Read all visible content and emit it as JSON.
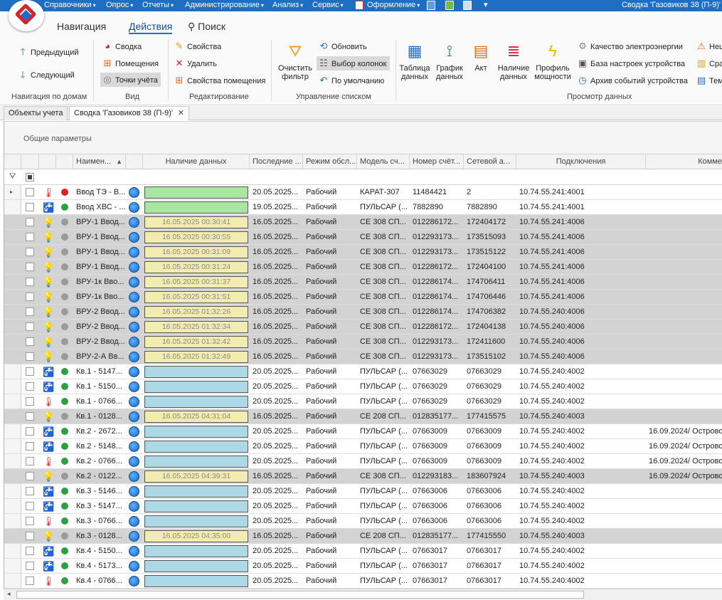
{
  "menu": [
    {
      "label": "Справочники"
    },
    {
      "label": "Опрос"
    },
    {
      "label": "Отчеты"
    },
    {
      "label": "Администрирование"
    },
    {
      "label": "Анализ"
    },
    {
      "label": "Сервис"
    },
    {
      "label": "Оформление"
    }
  ],
  "window_title": "Сводка 'Газовиков 38 (П-9)'",
  "ribbon_tabs": [
    {
      "label": "Навигация"
    },
    {
      "label": "Действия"
    },
    {
      "label": "Поиск"
    }
  ],
  "nav_group": {
    "prev": "Предыдущий",
    "next": "Следующий",
    "label": "Навигация по домам"
  },
  "view_group": {
    "summary": "Сводка",
    "rooms": "Помещения",
    "points": "Точки учёта",
    "label": "Вид"
  },
  "edit_group": {
    "props": "Свойства",
    "delete": "Удалить",
    "room_props": "Свойства помещения",
    "label": "Редактирование"
  },
  "list_group": {
    "clear_filter_1": "Очистить",
    "clear_filter_2": "фильтр",
    "refresh": "Обновить",
    "columns": "Выбор колонок",
    "default": "По умолчанию",
    "label": "Управление списком"
  },
  "view_data_group": {
    "table_1": "Таблица",
    "table_2": "данных",
    "graph_1": "График",
    "graph_2": "данных",
    "act": "Акт",
    "avail_1": "Наличие",
    "avail_2": "данных",
    "profile_1": "Профиль",
    "profile_2": "мощности",
    "quality": "Качество электроэнергии",
    "settings_db": "База настроек устройства",
    "events": "Архив событий устройства",
    "extra1": "Неш",
    "extra2": "Сра",
    "extra3": "Тем",
    "label": "Просмотр данных"
  },
  "doc_tabs": [
    {
      "label": "Объекты учета"
    },
    {
      "label": "Сводка 'Газовиков 38 (П-9)'"
    }
  ],
  "group_panel": "Общие параметры",
  "columns": {
    "name": "Наимен...",
    "avail": "Наличие данных",
    "last": "Последние ...",
    "mode": "Режим обсл...",
    "model": "Модель сч...",
    "serial": "Номер счёт...",
    "net": "Сетевой а...",
    "conn": "Подключения",
    "comment": "Комме"
  },
  "colors": {
    "green_bar": "#a8e6a1",
    "blue_bar": "#add8e6",
    "yellow_bar": "#f3ecb0",
    "grey_row": "#d3d3d3"
  },
  "rows": [
    {
      "type": "thermo",
      "status": "red",
      "name": "Ввод ТЭ - В...",
      "avail": "",
      "bar": "green",
      "last": "20.05.2025...",
      "mode": "Рабочий",
      "model": "КАРАТ-307",
      "serial": "11484421",
      "net": "2",
      "conn": "10.74.55.241:4001",
      "comment": "",
      "grey": false,
      "current": true
    },
    {
      "type": "water-cold",
      "status": "green",
      "name": "Ввод ХВС - ...",
      "avail": "",
      "bar": "green",
      "last": "19.05.2025...",
      "mode": "Рабочий",
      "model": "ПУЛЬСАР (...",
      "serial": "7882890",
      "net": "7882890",
      "conn": "10.74.55.241:4001",
      "comment": "",
      "grey": false
    },
    {
      "type": "bulb",
      "status": "grey",
      "name": "ВРУ-1 Ввод...",
      "avail": "16.05.2025 00:30:41",
      "bar": "yellow",
      "last": "16.05.2025...",
      "mode": "Рабочий",
      "model": "СЕ 308 СП...",
      "serial": "012286172...",
      "net": "172404172",
      "conn": "10.74.55.241:4006",
      "comment": "",
      "grey": true
    },
    {
      "type": "bulb",
      "status": "grey",
      "name": "ВРУ-1 Ввод...",
      "avail": "16.05.2025 00:30:55",
      "bar": "yellow",
      "last": "16.05.2025...",
      "mode": "Рабочий",
      "model": "СЕ 308 СП...",
      "serial": "012293173...",
      "net": "173515093",
      "conn": "10.74.55.241:4006",
      "comment": "",
      "grey": true
    },
    {
      "type": "bulb",
      "status": "grey",
      "name": "ВРУ-1 Ввод...",
      "avail": "16.05.2025 00:31:09",
      "bar": "yellow",
      "last": "16.05.2025...",
      "mode": "Рабочий",
      "model": "СЕ 308 СП...",
      "serial": "012293173...",
      "net": "173515122",
      "conn": "10.74.55.241:4006",
      "comment": "",
      "grey": true
    },
    {
      "type": "bulb",
      "status": "grey",
      "name": "ВРУ-1 Ввод...",
      "avail": "16.05.2025 00:31:24",
      "bar": "yellow",
      "last": "16.05.2025...",
      "mode": "Рабочий",
      "model": "СЕ 308 СП...",
      "serial": "012286172...",
      "net": "172404100",
      "conn": "10.74.55.241:4006",
      "comment": "",
      "grey": true
    },
    {
      "type": "bulb",
      "status": "grey",
      "name": "ВРУ-1к Вво...",
      "avail": "16.05.2025 00:31:37",
      "bar": "yellow",
      "last": "16.05.2025...",
      "mode": "Рабочий",
      "model": "СЕ 308 СП...",
      "serial": "012286174...",
      "net": "174706411",
      "conn": "10.74.55.241:4006",
      "comment": "",
      "grey": true
    },
    {
      "type": "bulb",
      "status": "grey",
      "name": "ВРУ-1к Вво...",
      "avail": "16.05.2025 00:31:51",
      "bar": "yellow",
      "last": "16.05.2025...",
      "mode": "Рабочий",
      "model": "СЕ 308 СП...",
      "serial": "012286174...",
      "net": "174706446",
      "conn": "10.74.55.241:4006",
      "comment": "",
      "grey": true
    },
    {
      "type": "bulb",
      "status": "grey",
      "name": "ВРУ-2 Ввод...",
      "avail": "16.05.2025 01:32:26",
      "bar": "yellow",
      "last": "16.05.2025...",
      "mode": "Рабочий",
      "model": "СЕ 308 СП...",
      "serial": "012286174...",
      "net": "174706382",
      "conn": "10.74.55.240:4006",
      "comment": "",
      "grey": true
    },
    {
      "type": "bulb",
      "status": "grey",
      "name": "ВРУ-2 Ввод...",
      "avail": "16.05.2025 01:32:34",
      "bar": "yellow",
      "last": "16.05.2025...",
      "mode": "Рабочий",
      "model": "СЕ 308 СП...",
      "serial": "012286172...",
      "net": "172404138",
      "conn": "10.74.55.240:4006",
      "comment": "",
      "grey": true
    },
    {
      "type": "bulb",
      "status": "grey",
      "name": "ВРУ-2 Ввод...",
      "avail": "16.05.2025 01:32:42",
      "bar": "yellow",
      "last": "16.05.2025...",
      "mode": "Рабочий",
      "model": "СЕ 308 СП...",
      "serial": "012293173...",
      "net": "172411600",
      "conn": "10.74.55.240:4006",
      "comment": "",
      "grey": true
    },
    {
      "type": "bulb",
      "status": "grey",
      "name": "ВРУ-2-А Вв...",
      "avail": "16.05.2025 01:32:49",
      "bar": "yellow",
      "last": "16.05.2025...",
      "mode": "Рабочий",
      "model": "СЕ 308 СП...",
      "serial": "012293173...",
      "net": "173515102",
      "conn": "10.74.55.240:4006",
      "comment": "",
      "grey": true
    },
    {
      "type": "water-cold",
      "status": "green",
      "name": "Кв.1 - 5147...",
      "avail": "",
      "bar": "blue",
      "last": "20.05.2025...",
      "mode": "Рабочий",
      "model": "ПУЛЬСАР (...",
      "serial": "07663029",
      "net": "07663029",
      "conn": "10.74.55.240:4002",
      "comment": "",
      "grey": false
    },
    {
      "type": "water-hot",
      "status": "green",
      "name": "Кв.1 - 5150...",
      "avail": "",
      "bar": "blue",
      "last": "20.05.2025...",
      "mode": "Рабочий",
      "model": "ПУЛЬСАР (...",
      "serial": "07663029",
      "net": "07663029",
      "conn": "10.74.55.240:4002",
      "comment": "",
      "grey": false
    },
    {
      "type": "thermo",
      "status": "green",
      "name": "Кв.1 - 0766...",
      "avail": "",
      "bar": "blue",
      "last": "20.05.2025...",
      "mode": "Рабочий",
      "model": "ПУЛЬСАР (...",
      "serial": "07663029",
      "net": "07663029",
      "conn": "10.74.55.240:4002",
      "comment": "",
      "grey": false
    },
    {
      "type": "bulb",
      "status": "grey",
      "name": "Кв.1 - 0128...",
      "avail": "16.05.2025 04:31:04",
      "bar": "yellow",
      "last": "16.05.2025...",
      "mode": "Рабочий",
      "model": "СЕ 208 СП...",
      "serial": "012835177...",
      "net": "177415575",
      "conn": "10.74.55.240:4003",
      "comment": "",
      "grey": true
    },
    {
      "type": "water-cold",
      "status": "green",
      "name": "Кв.2 - 2672...",
      "avail": "",
      "bar": "blue",
      "last": "20.05.2025...",
      "mode": "Рабочий",
      "model": "ПУЛЬСАР (...",
      "serial": "07663009",
      "net": "07663009",
      "conn": "10.74.55.240:4002",
      "comment": "16.09.2024/ Острово",
      "grey": false
    },
    {
      "type": "water-hot",
      "status": "green",
      "name": "Кв.2 - 5148...",
      "avail": "",
      "bar": "blue",
      "last": "20.05.2025...",
      "mode": "Рабочий",
      "model": "ПУЛЬСАР (...",
      "serial": "07663009",
      "net": "07663009",
      "conn": "10.74.55.240:4002",
      "comment": "16.09.2024/ Острово",
      "grey": false
    },
    {
      "type": "thermo",
      "status": "green",
      "name": "Кв.2 - 0766...",
      "avail": "",
      "bar": "blue",
      "last": "20.05.2025...",
      "mode": "Рабочий",
      "model": "ПУЛЬСАР (...",
      "serial": "07663009",
      "net": "07663009",
      "conn": "10.74.55.240:4002",
      "comment": "16.09.2024/ Острово",
      "grey": false
    },
    {
      "type": "bulb",
      "status": "grey",
      "name": "Кв.2 - 0122...",
      "avail": "16.05.2025 04:39:31",
      "bar": "yellow",
      "last": "16.05.2025...",
      "mode": "Рабочий",
      "model": "СЕ 308 СП...",
      "serial": "012293183...",
      "net": "183607924",
      "conn": "10.74.55.240:4003",
      "comment": "16.09.2024/ Острово",
      "grey": true
    },
    {
      "type": "water-cold",
      "status": "green",
      "name": "Кв.3 - 5146...",
      "avail": "",
      "bar": "blue",
      "last": "20.05.2025...",
      "mode": "Рабочий",
      "model": "ПУЛЬСАР (...",
      "serial": "07663006",
      "net": "07663006",
      "conn": "10.74.55.240:4002",
      "comment": "",
      "grey": false
    },
    {
      "type": "water-hot",
      "status": "green",
      "name": "Кв.3 - 5147...",
      "avail": "",
      "bar": "blue",
      "last": "20.05.2025...",
      "mode": "Рабочий",
      "model": "ПУЛЬСАР (...",
      "serial": "07663006",
      "net": "07663006",
      "conn": "10.74.55.240:4002",
      "comment": "",
      "grey": false
    },
    {
      "type": "thermo",
      "status": "green",
      "name": "Кв.3 - 0766...",
      "avail": "",
      "bar": "blue",
      "last": "20.05.2025...",
      "mode": "Рабочий",
      "model": "ПУЛЬСАР (...",
      "serial": "07663006",
      "net": "07663006",
      "conn": "10.74.55.240:4002",
      "comment": "",
      "grey": false
    },
    {
      "type": "bulb",
      "status": "grey",
      "name": "Кв.3 - 0128...",
      "avail": "16.05.2025 04:35:00",
      "bar": "yellow",
      "last": "16.05.2025...",
      "mode": "Рабочий",
      "model": "СЕ 208 СП...",
      "serial": "012835177...",
      "net": "177415550",
      "conn": "10.74.55.240:4003",
      "comment": "",
      "grey": true
    },
    {
      "type": "water-cold",
      "status": "green",
      "name": "Кв.4 - 5150...",
      "avail": "",
      "bar": "blue",
      "last": "20.05.2025...",
      "mode": "Рабочий",
      "model": "ПУЛЬСАР (...",
      "serial": "07663017",
      "net": "07663017",
      "conn": "10.74.55.240:4002",
      "comment": "",
      "grey": false
    },
    {
      "type": "water-hot",
      "status": "green",
      "name": "Кв.4 - 5173...",
      "avail": "",
      "bar": "blue",
      "last": "20.05.2025...",
      "mode": "Рабочий",
      "model": "ПУЛЬСАР (...",
      "serial": "07663017",
      "net": "07663017",
      "conn": "10.74.55.240:4002",
      "comment": "",
      "grey": false
    },
    {
      "type": "thermo",
      "status": "green",
      "name": "Кв.4 - 0766...",
      "avail": "",
      "bar": "blue",
      "last": "20.05.2025...",
      "mode": "Рабочий",
      "model": "ПУЛЬСАР (...",
      "serial": "07663017",
      "net": "07663017",
      "conn": "10.74.55.240:4002",
      "comment": "",
      "grey": false
    }
  ]
}
